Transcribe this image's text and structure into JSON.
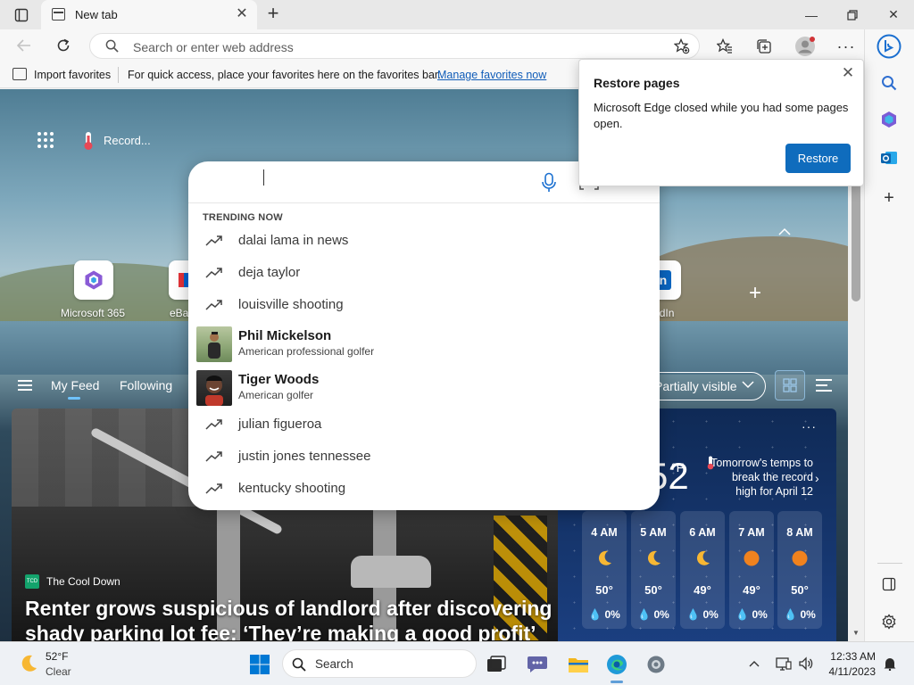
{
  "browser": {
    "tab_title": "New tab",
    "address_placeholder": "Search or enter web address"
  },
  "favorites_bar": {
    "import_label": "Import favorites",
    "message": "For quick access, place your favorites here on the favorites bar.",
    "manage_link": "Manage favorites now"
  },
  "new_tab_page": {
    "weather_chip": "Record...",
    "quick_links": [
      {
        "label": "Microsoft 365",
        "icon": "microsoft-365-icon"
      },
      {
        "label": "eBay",
        "icon": "ebay-icon"
      },
      {
        "label": "LinkedIn",
        "icon": "linkedin-icon"
      }
    ],
    "feed_tabs": [
      "My Feed",
      "Following"
    ],
    "visibility_select": "Partially visible",
    "news": {
      "source": "The Cool Down",
      "source_logo_text": "TCD",
      "headline": "Renter grows suspicious of landlord after discovering shady parking lot fee: ‘They’re making a good profit’"
    },
    "weather": {
      "temp": "52",
      "unit": "°F",
      "alert": "Tomorrow's temps to break the record high for April 12",
      "hours": [
        {
          "time": "4 AM",
          "icon": "moon-icon",
          "temp": "50°",
          "precip": "0%"
        },
        {
          "time": "5 AM",
          "icon": "moon-icon",
          "temp": "50°",
          "precip": "0%"
        },
        {
          "time": "6 AM",
          "icon": "moon-icon",
          "temp": "49°",
          "precip": "0%"
        },
        {
          "time": "7 AM",
          "icon": "sun-icon",
          "temp": "49°",
          "precip": "0%"
        },
        {
          "time": "8 AM",
          "icon": "sun-icon",
          "temp": "50°",
          "precip": "0%"
        }
      ]
    }
  },
  "search_dropdown": {
    "heading": "TRENDING NOW",
    "items": [
      {
        "type": "trend",
        "text": "dalai lama in news"
      },
      {
        "type": "trend",
        "text": "deja taylor"
      },
      {
        "type": "trend",
        "text": "louisville shooting"
      },
      {
        "type": "entity",
        "name": "Phil Mickelson",
        "desc": "American professional golfer"
      },
      {
        "type": "entity",
        "name": "Tiger Woods",
        "desc": "American golfer"
      },
      {
        "type": "trend",
        "text": "julian figueroa"
      },
      {
        "type": "trend",
        "text": "justin jones tennessee"
      },
      {
        "type": "trend",
        "text": "kentucky shooting"
      }
    ]
  },
  "restore_popup": {
    "title": "Restore pages",
    "message": "Microsoft Edge closed while you had some pages open.",
    "button": "Restore"
  },
  "taskbar": {
    "weather_temp": "52°F",
    "weather_cond": "Clear",
    "search_label": "Search",
    "time": "12:33 AM",
    "date": "4/11/2023"
  },
  "colors": {
    "accent": "#0f6cbd",
    "link": "#0f5cb8"
  }
}
